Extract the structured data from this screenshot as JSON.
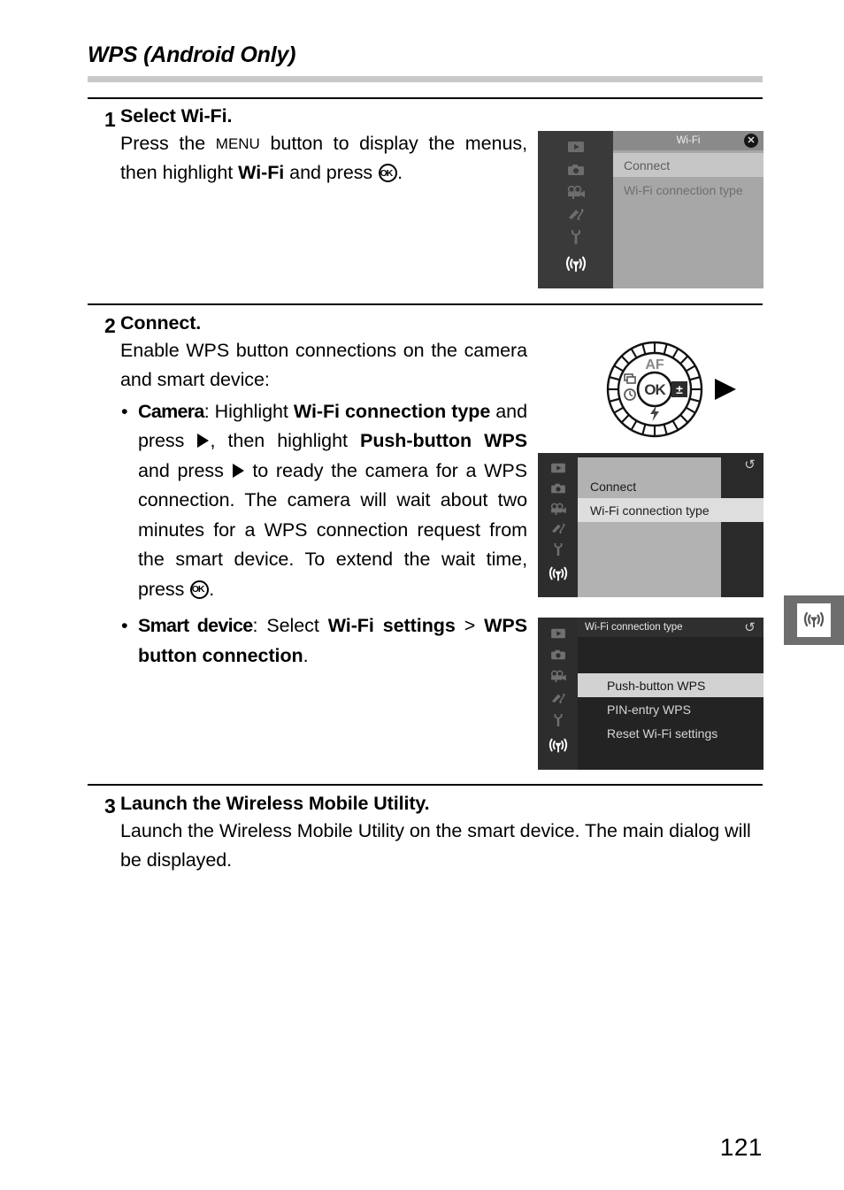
{
  "header": {
    "title": "WPS (Android Only)"
  },
  "steps": [
    {
      "number": "1",
      "heading_prefix": "Select ",
      "heading_bold": "Wi-Fi",
      "heading_suffix": ".",
      "body_parts": {
        "t1": "Press the ",
        "menu_glyph": "MENU",
        "t2": " button to display the menus, then highlight ",
        "b1": "Wi-Fi",
        "t3": " and press ",
        "ok_glyph": "OK",
        "t4": "."
      }
    },
    {
      "number": "2",
      "heading": "Connect.",
      "intro": "Enable WPS button connections on the camera and smart device:",
      "bullets": [
        {
          "dot": "•",
          "condition": "Camera",
          "colon": ": ",
          "parts": {
            "t1": "Highlight ",
            "b1": "Wi-Fi connection type",
            "t2": " and press ",
            "arrow1": "▶",
            "t3": ", then highlight ",
            "b2": "Push-button WPS",
            "t4": " and press ",
            "arrow2": "▶",
            "t5": " to ready the camera for a WPS connection.  The camera will wait about two minutes for a WPS connection request from the smart device.  To extend the wait time, press ",
            "ok_glyph": "OK",
            "t6": "."
          }
        },
        {
          "dot": "•",
          "condition": "Smart device",
          "colon": ": ",
          "parts": {
            "t1": "Select ",
            "b1": "Wi-Fi settings",
            "t2": " > ",
            "b2": "WPS button connection",
            "t3": "."
          }
        }
      ]
    },
    {
      "number": "3",
      "heading": "Launch the Wireless Mobile Utility.",
      "body": "Launch the Wireless Mobile Utility on the smart device.  The main dialog will be displayed."
    }
  ],
  "menus": [
    {
      "id": "menu1",
      "state": "faded",
      "header_title": "Wi-Fi",
      "close_icon": "✕",
      "sidebar_icons": [
        "playback-icon",
        "photo-shooting-icon",
        "movie-shooting-icon",
        "retouch-icon",
        "setup-wrench-icon",
        "wifi-antenna-icon"
      ],
      "active_sidebar_index": 5,
      "rows": [
        {
          "label": "Connect",
          "selected": true
        },
        {
          "label": "Wi-Fi connection type",
          "selected": false
        }
      ]
    },
    {
      "id": "menu2",
      "state": "normal",
      "header_title": "",
      "back_icon": "↺",
      "sidebar_icons": [
        "playback-icon",
        "photo-shooting-icon",
        "movie-shooting-icon",
        "retouch-icon",
        "setup-wrench-icon",
        "wifi-antenna-icon"
      ],
      "active_sidebar_index": 5,
      "rows": [
        {
          "label": "Connect",
          "selected": false
        },
        {
          "label": "Wi-Fi connection type",
          "selected": true
        }
      ]
    },
    {
      "id": "menu3",
      "state": "normal",
      "header_title": "Wi-Fi connection type",
      "back_icon": "↺",
      "sidebar_icons": [
        "playback-icon",
        "photo-shooting-icon",
        "movie-shooting-icon",
        "retouch-icon",
        "setup-wrench-icon",
        "wifi-antenna-icon"
      ],
      "active_sidebar_index": 5,
      "rows": [
        {
          "label": "Push-button WPS",
          "selected": true
        },
        {
          "label": "PIN-entry WPS",
          "selected": false
        },
        {
          "label": "Reset Wi-Fi settings",
          "selected": false
        }
      ]
    }
  ],
  "dial": {
    "name": "multi-selector-dial",
    "top_label": "AF",
    "center_label": "OK",
    "left_icons": [
      "release-mode-icon",
      "self-timer-icon"
    ],
    "right_icon": "exposure-compensation-icon",
    "bottom_icon": "flash-icon",
    "pointer": "▶"
  },
  "side_tab": {
    "icon": "wifi-antenna-icon",
    "color": "#6e6e6e"
  },
  "footer": {
    "page_number": "121"
  },
  "colors": {
    "title_rule": "#c9c9c9",
    "rule": "#000000",
    "menu_dark": "#2b2b2b",
    "menu_faded_panel": "#a7a7a7",
    "highlight": "#d2d2d2"
  }
}
